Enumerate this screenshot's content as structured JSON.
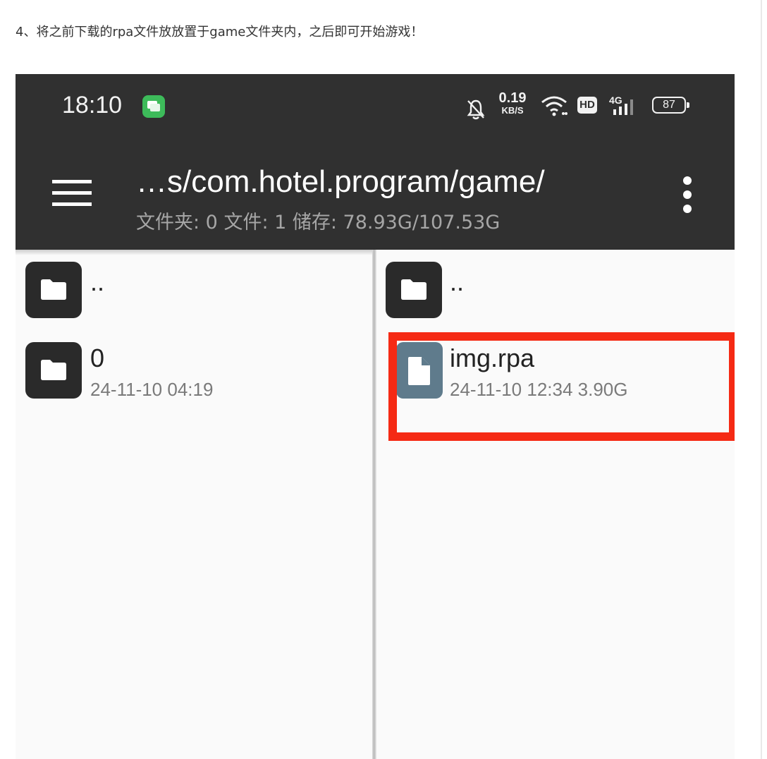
{
  "instruction": {
    "text": "4、将之前下载的rpa文件放放置于game文件夹内，之后即可开始游戏！"
  },
  "status_bar": {
    "time": "18:10",
    "net_speed_value": "0.19",
    "net_speed_unit": "KB/S",
    "hd_label": "HD",
    "signal_label": "4G",
    "battery_level": "87",
    "icons": [
      "chat-app-icon",
      "bell-muted-icon",
      "wifi-icon",
      "hd-icon",
      "signal-icon",
      "battery-icon"
    ]
  },
  "toolbar": {
    "path": "…s/com.hotel.program/game/",
    "stats": "文件夹: 0  文件: 1  储存: 78.93G/107.53G",
    "icons": [
      "menu-icon",
      "more-vert-icon"
    ]
  },
  "left_pane": {
    "items": [
      {
        "name": "..",
        "meta": "",
        "icon": "folder-icon"
      },
      {
        "name": "0",
        "meta": "24-11-10 04:19",
        "icon": "folder-icon"
      }
    ]
  },
  "right_pane": {
    "items": [
      {
        "name": "..",
        "meta": "",
        "icon": "folder-icon"
      },
      {
        "name": "img.rpa",
        "meta": "24-11-10 12:34  3.90G",
        "icon": "file-icon"
      }
    ]
  },
  "colors": {
    "appbar": "#303030",
    "highlight": "#f52a14",
    "chat_green": "#3dbb5a",
    "file_tile": "#5f7b8c"
  }
}
